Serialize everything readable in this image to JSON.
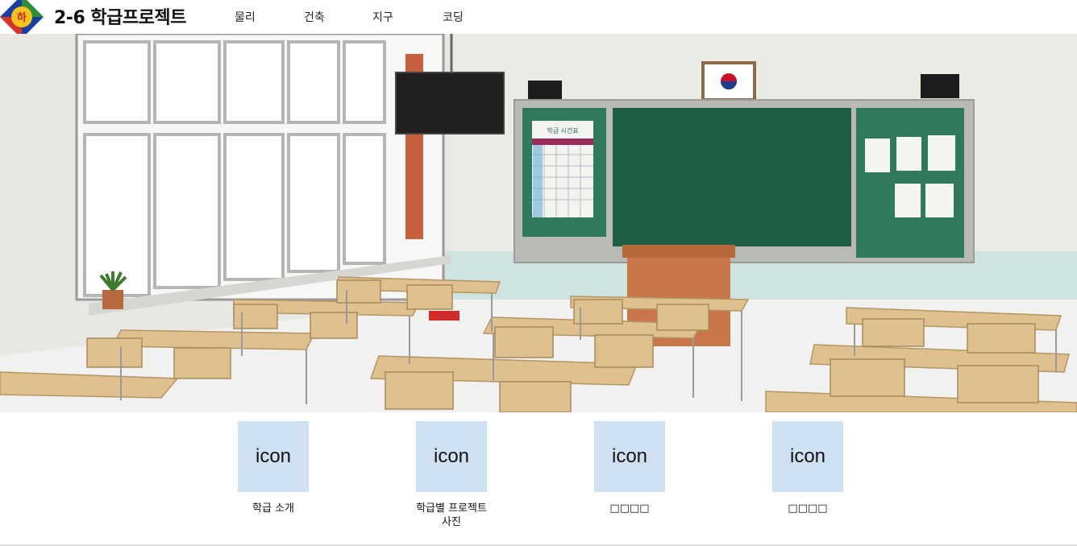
{
  "header": {
    "logo_icon": "school-emblem-icon",
    "logo_text": "하",
    "title": "2-6 학급프로젝트",
    "nav": [
      "물리",
      "건축",
      "지구",
      "코딩"
    ]
  },
  "hero": {
    "image": "classroom-illustration",
    "calendar_title": "학급 시간표"
  },
  "tiles": [
    {
      "icon": "icon",
      "label": "학급 소개"
    },
    {
      "icon": "icon",
      "label": "학급별 프로젝트\n사진"
    },
    {
      "icon": "icon",
      "label": "□□□□"
    },
    {
      "icon": "icon",
      "label": "□□□□"
    }
  ],
  "colors": {
    "tile_bg": "#cfe0f2",
    "board_green": "#1f5e44",
    "side_board": "#2f7a5c"
  }
}
